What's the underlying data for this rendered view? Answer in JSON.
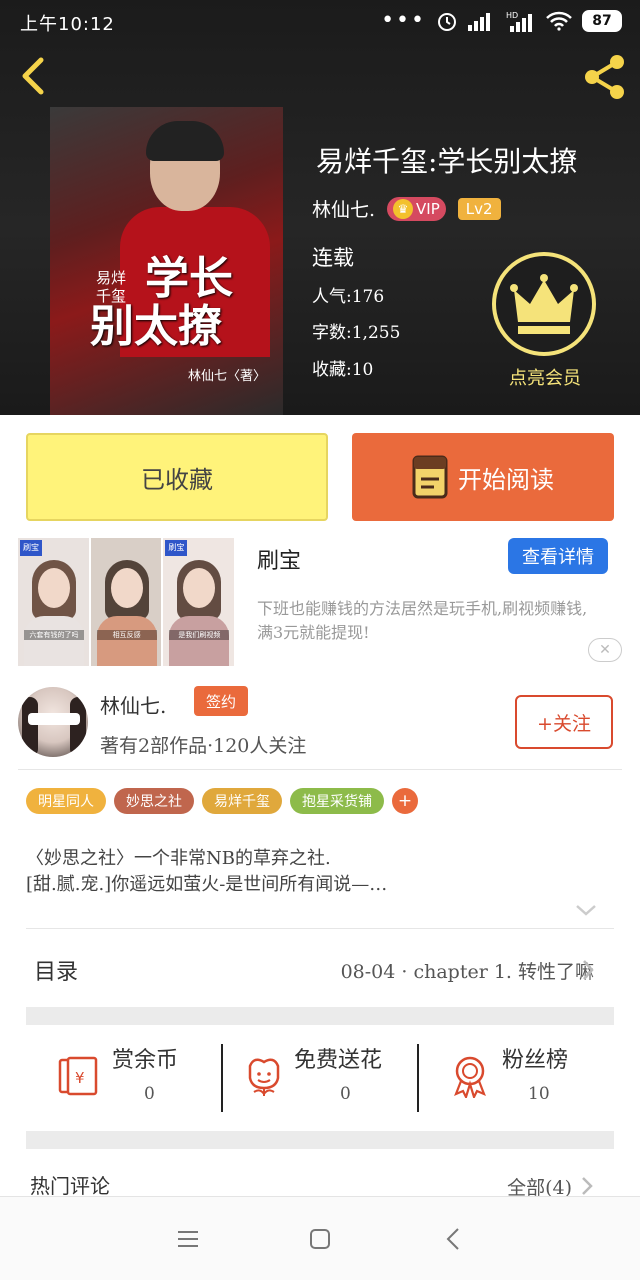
{
  "status_bar": {
    "time": "上午10:12",
    "battery": "87",
    "dots": "•••"
  },
  "book": {
    "title": "易烊千玺:学长别太撩",
    "author": "林仙七.",
    "vip_label": "VIP",
    "level": "Lv2",
    "status": "连载",
    "popularity": "人气:176",
    "word_count": "字数:1,255",
    "favorites": "收藏:10",
    "vip_button_label": "点亮会员"
  },
  "cover": {
    "small_title": "易烊\n千玺",
    "big_title_line1": "学长",
    "big_title_line2": "别太撩",
    "author": "林仙七〈著〉"
  },
  "actions": {
    "favorited_label": "已收藏",
    "start_reading_label": "开始阅读"
  },
  "ad": {
    "title": "刷宝",
    "detail_button": "查看详情",
    "description": "下班也能赚钱的方法居然是玩手机,刷视频赚钱,满3元就能提现!",
    "close": "✕",
    "thumbnails": [
      {
        "tag": "刷宝",
        "caption": "六套有钱的了吗"
      },
      {
        "tag": "",
        "caption": "相互反感"
      },
      {
        "tag": "刷宝",
        "caption": "是我们刷视频"
      }
    ]
  },
  "author_card": {
    "name": "林仙七.",
    "signed_badge": "签约",
    "stats": "著有2部作品·120人关注",
    "follow_button": "+关注"
  },
  "tags": [
    {
      "label": "明星同人",
      "color": "#f0b23e"
    },
    {
      "label": "妙思之社",
      "color": "#c0664d"
    },
    {
      "label": "易烊千玺",
      "color": "#e0a83c"
    },
    {
      "label": "抱星采货铺",
      "color": "#8dbb4a"
    }
  ],
  "tag_add": "+",
  "intro": {
    "line1": "〈妙思之社〉一个非常NB的草弃之社.",
    "line2": "[甜.腻.宠.]你遥远如萤火-是世间所有闻说—…"
  },
  "toc": {
    "label": "目录",
    "latest": "08-04 · chapter 1. 转性了嘛"
  },
  "rewards": [
    {
      "label": "赏余币",
      "value": "0",
      "icon": "red-packet-icon"
    },
    {
      "label": "免费送花",
      "value": "0",
      "icon": "flower-icon"
    },
    {
      "label": "粉丝榜",
      "value": "10",
      "icon": "medal-icon"
    }
  ],
  "comments": {
    "label": "热门评论",
    "all": "全部(4)"
  },
  "colors": {
    "accent_orange": "#ea6a3c",
    "favorite_yellow": "#fff37a",
    "ad_blue": "#2b76e5",
    "vip_gold": "#f5e37a"
  }
}
